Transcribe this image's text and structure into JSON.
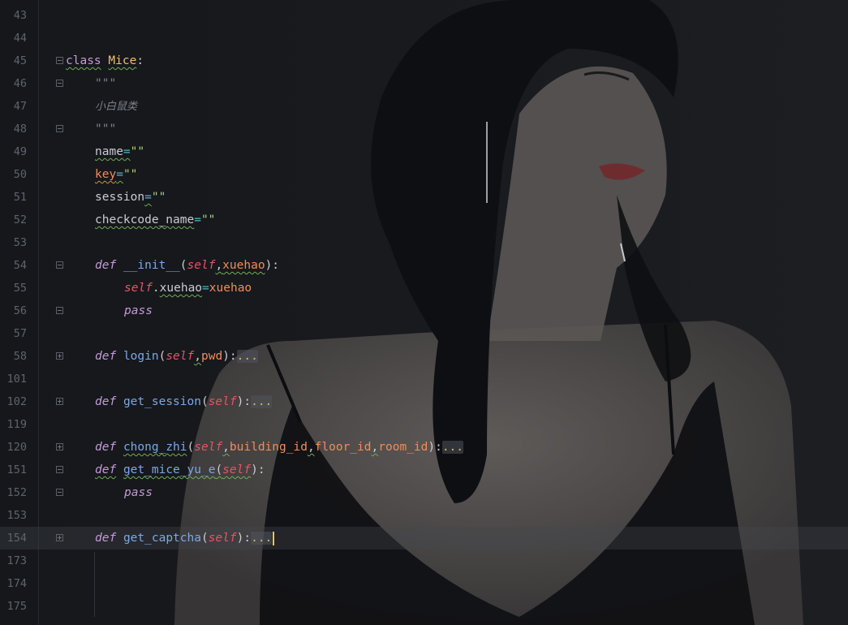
{
  "editor": {
    "lines": [
      {
        "num": "43"
      },
      {
        "num": "44"
      },
      {
        "num": "45",
        "t1": "class",
        "t2": "Mice",
        "t3": ":"
      },
      {
        "num": "46",
        "t1": "\"\"\""
      },
      {
        "num": "47",
        "t1": "小白鼠类"
      },
      {
        "num": "48",
        "t1": "\"\"\""
      },
      {
        "num": "49",
        "t1": "name",
        "t2": "=",
        "t3": "\"\""
      },
      {
        "num": "50",
        "t1": "key",
        "t2": "=",
        "t3": "\"\""
      },
      {
        "num": "51",
        "t1": "session",
        "t2": "=",
        "t3": "\"\""
      },
      {
        "num": "52",
        "t1": "checkcode_name",
        "t2": "=",
        "t3": "\"\""
      },
      {
        "num": "53"
      },
      {
        "num": "54",
        "t1": "def",
        "t2": "__init__",
        "t3": "(",
        "t4": "self",
        "t5": ",",
        "t6": "xuehao",
        "t7": "):"
      },
      {
        "num": "55",
        "t1": "self",
        "t2": ".",
        "t3": "xuehao",
        "t4": "=",
        "t5": "xuehao"
      },
      {
        "num": "56",
        "t1": "pass"
      },
      {
        "num": "57"
      },
      {
        "num": "58",
        "t1": "def",
        "t2": "login",
        "t3": "(",
        "t4": "self",
        "t5": ",",
        "t6": "pwd",
        "t7": "):",
        "t8": "..."
      },
      {
        "num": "101"
      },
      {
        "num": "102",
        "t1": "def",
        "t2": "get_session",
        "t3": "(",
        "t4": "self",
        "t5": "):",
        "t6": "..."
      },
      {
        "num": "119"
      },
      {
        "num": "120",
        "t1": "def",
        "t2": "chong_zhi",
        "t3": "(",
        "t4": "self",
        "t5": ",",
        "t6": "building_id",
        "t7": ",",
        "t8": "floor_id",
        "t9": ",",
        "t10": "room_id",
        "t11": "):",
        "t12": "..."
      },
      {
        "num": "151",
        "t1": "def",
        "t2": "get_mice_yu_e",
        "t3": "(",
        "t4": "self",
        "t5": "):"
      },
      {
        "num": "152",
        "t1": "pass"
      },
      {
        "num": "153"
      },
      {
        "num": "154",
        "t1": "def",
        "t2": "get_captcha",
        "t3": "(",
        "t4": "self",
        "t5": "):",
        "t6": "..."
      },
      {
        "num": "173"
      },
      {
        "num": "174"
      },
      {
        "num": "175"
      }
    ]
  },
  "colors": {
    "background": "#15171b",
    "keyword": "#c49bd8",
    "class_name": "#e8c26d",
    "function": "#7aa8e8",
    "self": "#e55563",
    "parameter": "#f08c5c",
    "string": "#a7d07a",
    "line_number": "#5e646d",
    "caret": "#f0c94b"
  },
  "background_image": "illustrated-woman-wallpaper"
}
